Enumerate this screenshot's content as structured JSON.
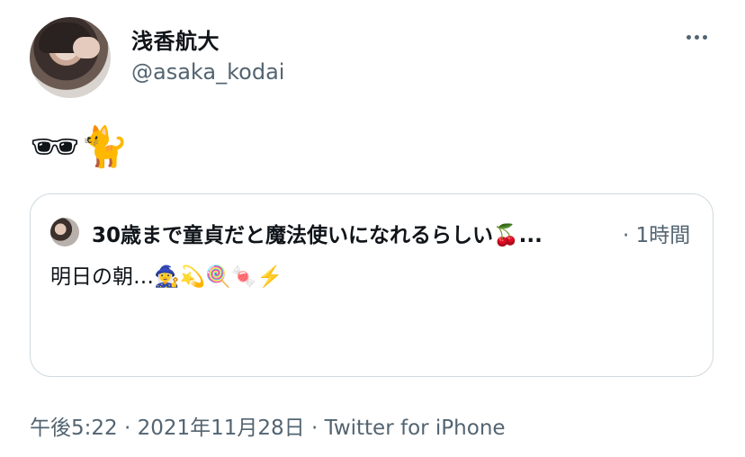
{
  "author": {
    "display_name": "浅香航大",
    "handle": "@asaka_kodai"
  },
  "menu_icon": "more-horizontal-icon",
  "tweet": {
    "text": "🕶🐈"
  },
  "quoted_tweet": {
    "author_display": "30歳まで童貞だと魔法使いになれるらしい🍒...",
    "time": "· 1時間",
    "text": "明日の朝…🧙‍♀️💫🍭🍬⚡️"
  },
  "meta": {
    "timestamp": "午後5:22 · 2021年11月28日 · Twitter for iPhone"
  },
  "colors": {
    "text": "#0f1419",
    "secondary": "#536471",
    "border": "#cfd9de"
  }
}
